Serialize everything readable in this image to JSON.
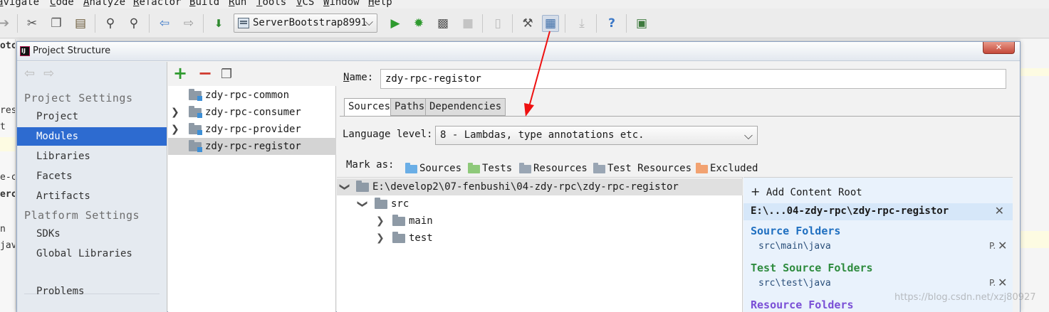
{
  "menubar": {
    "items": [
      "avigate",
      "Code",
      "Analyze",
      "Refactor",
      "Build",
      "Run",
      "Tools",
      "VCS",
      "Window",
      "Help"
    ]
  },
  "toolbar": {
    "run_configuration": "ServerBootstrap8991",
    "icons": [
      "forward-icon",
      "cut-icon",
      "copy-icon",
      "paste-icon",
      "find-icon",
      "replace-icon",
      "back-icon",
      "forward-nav-icon",
      "build-icon",
      "run-icon",
      "debug-icon",
      "coverage-icon",
      "stop-icon",
      "vcs-icon",
      "settings-icon",
      "project-structure-icon",
      "download-icon",
      "help-icon",
      "sdk-icon"
    ]
  },
  "background_editor": {
    "left_peek": [
      "otc",
      "res",
      "t",
      "e-c",
      "erc",
      "n",
      "jav"
    ]
  },
  "dialog": {
    "title": "Project Structure",
    "close_label": "✕",
    "sidebar": {
      "project_settings_label": "Project Settings",
      "project_items": [
        "Project",
        "Modules",
        "Libraries",
        "Facets",
        "Artifacts"
      ],
      "selected": "Modules",
      "platform_settings_label": "Platform Settings",
      "platform_items": [
        "SDKs",
        "Global Libraries"
      ],
      "problems_label": "Problems"
    },
    "modules": {
      "add_label": "+",
      "remove_label": "−",
      "items": [
        {
          "name": "zdy-rpc-common",
          "expandable": false
        },
        {
          "name": "zdy-rpc-consumer",
          "expandable": true
        },
        {
          "name": "zdy-rpc-provider",
          "expandable": true
        },
        {
          "name": "zdy-rpc-registor",
          "expandable": false
        }
      ],
      "selected": "zdy-rpc-registor"
    },
    "content": {
      "name_label": "Name:",
      "name_value": "zdy-rpc-registor",
      "tabs": [
        "Sources",
        "Paths",
        "Dependencies"
      ],
      "active_tab": "Sources",
      "language_level_label": "Language level:",
      "language_level_value": "8 - Lambdas, type annotations etc.",
      "mark_as_label": "Mark as:",
      "mark_as": [
        {
          "label": "Sources",
          "color": "#6aaee6"
        },
        {
          "label": "Tests",
          "color": "#8ec97a"
        },
        {
          "label": "Resources",
          "color": "#9aa6b4"
        },
        {
          "label": "Test Resources",
          "color": "#9aa6b4"
        },
        {
          "label": "Excluded",
          "color": "#f2a271"
        }
      ],
      "tree": {
        "root": "E:\\develop2\\07-fenbushi\\04-zdy-rpc\\zdy-rpc-registor",
        "src": "src",
        "main": "main",
        "test": "test"
      },
      "roots": {
        "add_content_root": "Add Content Root",
        "root_path": "E:\\...04-zdy-rpc\\zdy-rpc-registor",
        "source_folders_label": "Source Folders",
        "source_folders_color": "#1f6fc0",
        "source_path": "src\\main\\java",
        "test_source_folders_label": "Test Source Folders",
        "test_source_folders_color": "#2e8b3e",
        "test_path": "src\\test\\java",
        "resource_folders_label": "Resource Folders",
        "resource_folders_color": "#7a4fd6",
        "package_prefix_label": "P."
      }
    }
  },
  "watermark": "https://blog.csdn.net/xzj80927"
}
